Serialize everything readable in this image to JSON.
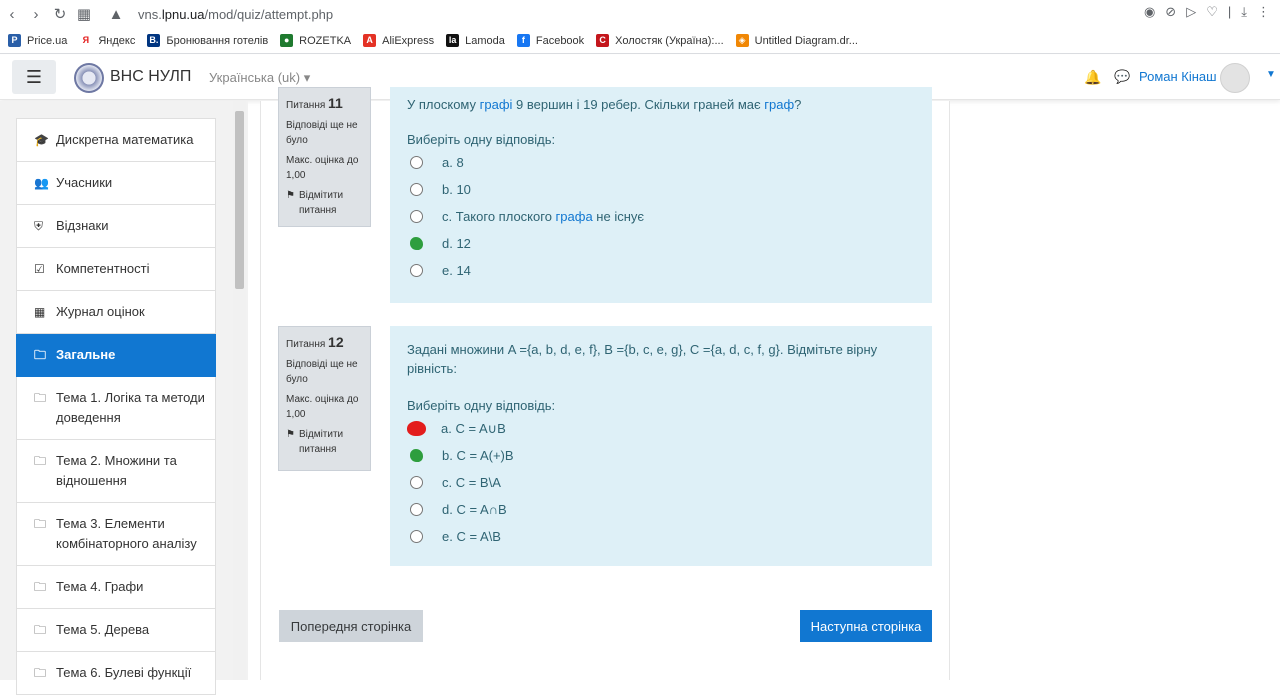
{
  "browser": {
    "url_prefix": "vns.",
    "url_domain": "lpnu.ua",
    "url_path": "/mod/quiz/attempt.php"
  },
  "bookmarks": [
    {
      "label": "Price.ua",
      "icon": "price-icon",
      "color": "#2a5fa8",
      "glyph": "P"
    },
    {
      "label": "Яндекс",
      "icon": "yandex-icon",
      "color": "#ffffff",
      "glyph": "Я"
    },
    {
      "label": "Бронювання готелів",
      "icon": "booking-icon",
      "color": "#003580",
      "glyph": "B."
    },
    {
      "label": "ROZETKA",
      "icon": "rozetka-icon",
      "color": "#1f7a2f",
      "glyph": "●"
    },
    {
      "label": "AliExpress",
      "icon": "aliexpress-icon",
      "color": "#e43225",
      "glyph": "A"
    },
    {
      "label": "Lamoda",
      "icon": "lamoda-icon",
      "color": "#111111",
      "glyph": "la"
    },
    {
      "label": "Facebook",
      "icon": "facebook-icon",
      "color": "#1877f2",
      "glyph": "f"
    },
    {
      "label": "Холостяк (Україна):...",
      "icon": "stb-icon",
      "color": "#c4161c",
      "glyph": "C"
    },
    {
      "label": "Untitled Diagram.dr...",
      "icon": "drawio-icon",
      "color": "#f08705",
      "glyph": "◈"
    }
  ],
  "navbar": {
    "brand": "ВНС НУЛП",
    "language": "Українська (uk)",
    "user": "Роман Кінаш"
  },
  "drawer": {
    "items": [
      {
        "label": "Дискретна математика",
        "icon": "graduation-cap-icon",
        "glyph": "🎓"
      },
      {
        "label": "Учасники",
        "icon": "users-icon",
        "glyph": "👥"
      },
      {
        "label": "Відзнаки",
        "icon": "shield-icon",
        "glyph": "⛨"
      },
      {
        "label": "Компетентності",
        "icon": "checkbox-icon",
        "glyph": "☑"
      },
      {
        "label": "Журнал оцінок",
        "icon": "table-icon",
        "glyph": "▦"
      },
      {
        "label": "Загальне",
        "icon": "folder-icon",
        "glyph": "🗀",
        "active": true
      },
      {
        "label": "Тема 1. Логіка та методи доведення",
        "icon": "folder-icon",
        "glyph": "🗀"
      },
      {
        "label": "Тема 2. Множини та відношення",
        "icon": "folder-icon",
        "glyph": "🗀"
      },
      {
        "label": "Тема 3. Елементи комбінаторного аналізу",
        "icon": "folder-icon",
        "glyph": "🗀"
      },
      {
        "label": "Тема 4. Графи",
        "icon": "folder-icon",
        "glyph": "🗀"
      },
      {
        "label": "Тема 5. Дерева",
        "icon": "folder-icon",
        "glyph": "🗀"
      },
      {
        "label": "Тема 6. Булеві функції",
        "icon": "folder-icon",
        "glyph": "🗀"
      }
    ]
  },
  "q11": {
    "label": "Питання",
    "number": "11",
    "status": "Відповіді ще не було",
    "mark": "Макс. оцінка до 1,00",
    "flag": "Відмітити питання",
    "text_a": "У плоскому ",
    "text_link1": "графі",
    "text_b": " 9 вершин і 19 ребер. Скільки граней має ",
    "text_link2": "граф",
    "text_c": "?",
    "prompt": "Виберіть одну відповідь:",
    "answers": [
      {
        "text": "a. 8",
        "mark": "none"
      },
      {
        "text": "b. 10",
        "mark": "none"
      },
      {
        "text_a": "c. Такого плоского ",
        "text_link": "графа",
        "text_b": " не існує",
        "mark": "none"
      },
      {
        "text": "d. 12",
        "mark": "green"
      },
      {
        "text": "e. 14",
        "mark": "none"
      }
    ]
  },
  "q12": {
    "label": "Питання",
    "number": "12",
    "status": "Відповіді ще не було",
    "mark": "Макс. оцінка до 1,00",
    "flag": "Відмітити питання",
    "text": "Задані множини A ={a, b, d, e, f}, B ={b, c, e, g}, C ={a, d, c, f, g}. Відмітьте вірну рівність:",
    "prompt": "Виберіть одну відповідь:",
    "answers": [
      {
        "text": "a. C = A∪B",
        "mark": "red"
      },
      {
        "text": "b. C = A(+)B",
        "mark": "green"
      },
      {
        "text": "c. C = B\\A",
        "mark": "none"
      },
      {
        "text": "d. C = A∩B",
        "mark": "none"
      },
      {
        "text": "e. C = A\\B",
        "mark": "none"
      }
    ]
  },
  "buttons": {
    "prev": "Попередня сторінка",
    "next": "Наступна сторінка"
  }
}
